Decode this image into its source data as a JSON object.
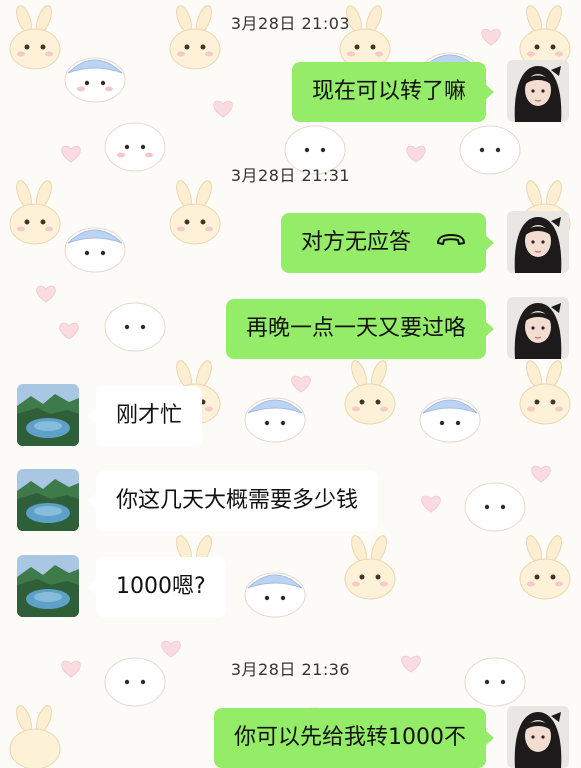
{
  "timestamps": [
    "3月28日 21:03",
    "3月28日 21:31",
    "3月28日 21:36"
  ],
  "messages": [
    {
      "side": "me",
      "text": "现在可以转了嘛"
    },
    {
      "side": "me",
      "text": "对方无应答",
      "icon": "phone-hangup-icon"
    },
    {
      "side": "me",
      "text": "再晚一点一天又要过咯"
    },
    {
      "side": "them",
      "text": "刚才忙"
    },
    {
      "side": "them",
      "text": "你这几天大概需要多少钱"
    },
    {
      "side": "them",
      "text": "1000嗯?"
    },
    {
      "side": "me",
      "text": "你可以先给我转1000不"
    }
  ],
  "colors": {
    "my_bubble": "#95ec69",
    "their_bubble": "#ffffff",
    "background": "#fdfbf7"
  }
}
